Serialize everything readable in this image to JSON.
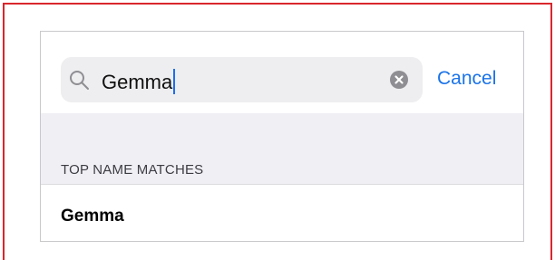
{
  "search": {
    "query": "Gemma",
    "cancel_label": "Cancel"
  },
  "results": {
    "section_header": "TOP NAME MATCHES",
    "items": [
      {
        "name": "Gemma"
      }
    ]
  },
  "icons": {
    "search": "magnifying-glass",
    "clear": "x-circle-fill"
  },
  "colors": {
    "accent": "#1a73e8",
    "caret": "#1b6ef2",
    "frame": "#d9262c",
    "field_background": "#eeeef0",
    "group_background": "#efeff4"
  }
}
